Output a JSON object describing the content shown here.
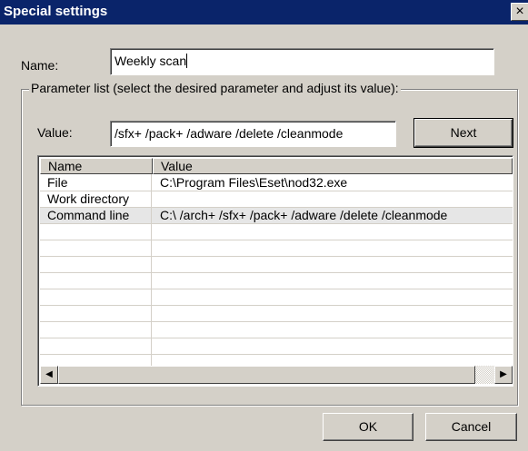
{
  "window": {
    "title": "Special settings",
    "close_glyph": "×"
  },
  "name_field": {
    "label": "Name:",
    "value": "Weekly scan"
  },
  "parameter_group": {
    "legend": "Parameter list (select the desired parameter and adjust its value):"
  },
  "value_field": {
    "label": "Value:",
    "value": "/sfx+ /pack+ /adware /delete /cleanmode"
  },
  "buttons": {
    "next": "Next",
    "ok": "OK",
    "cancel": "Cancel"
  },
  "list": {
    "columns": [
      "Name",
      "Value"
    ],
    "rows": [
      {
        "name": "File",
        "value": "C:\\Program Files\\Eset\\nod32.exe"
      },
      {
        "name": "Work directory",
        "value": ""
      },
      {
        "name": "Command line",
        "value": "C:\\ /arch+ /sfx+ /pack+ /adware /delete /cleanmode"
      }
    ],
    "selected_row": 2
  },
  "scrollbar": {
    "left_arrow": "◀",
    "right_arrow": "▶"
  }
}
